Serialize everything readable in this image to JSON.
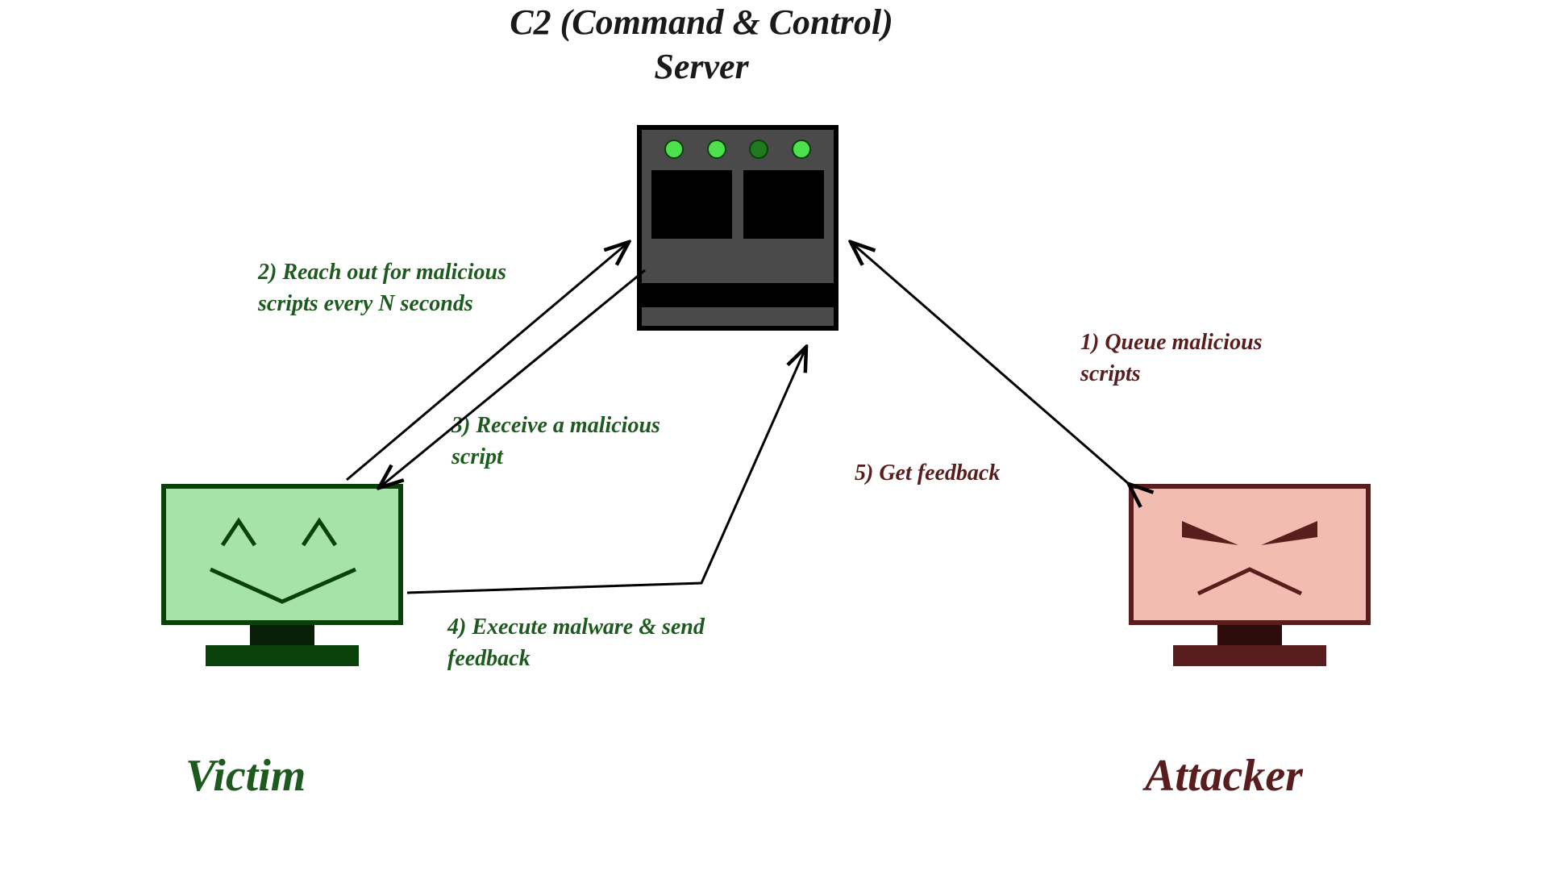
{
  "title": "C2 (Command & Control) Server",
  "nodes": {
    "victim": "Victim",
    "attacker": "Attacker"
  },
  "steps": {
    "s1": "1) Queue malicious scripts",
    "s2": "2) Reach out for malicious scripts every N seconds",
    "s3": "3) Receive a malicious script",
    "s4": "4) Execute malware & send feedback",
    "s5": "5) Get feedback"
  },
  "chart_data": {
    "type": "flow-diagram",
    "nodes": [
      {
        "id": "server",
        "label": "C2 (Command & Control) Server"
      },
      {
        "id": "victim",
        "label": "Victim"
      },
      {
        "id": "attacker",
        "label": "Attacker"
      }
    ],
    "edges": [
      {
        "from": "attacker",
        "to": "server",
        "label": "1) Queue malicious scripts"
      },
      {
        "from": "victim",
        "to": "server",
        "label": "2) Reach out for malicious scripts every N seconds"
      },
      {
        "from": "server",
        "to": "victim",
        "label": "3) Receive a malicious script"
      },
      {
        "from": "victim",
        "to": "server",
        "label": "4) Execute malware & send feedback"
      },
      {
        "from": "server",
        "to": "attacker",
        "label": "5) Get feedback"
      }
    ]
  }
}
